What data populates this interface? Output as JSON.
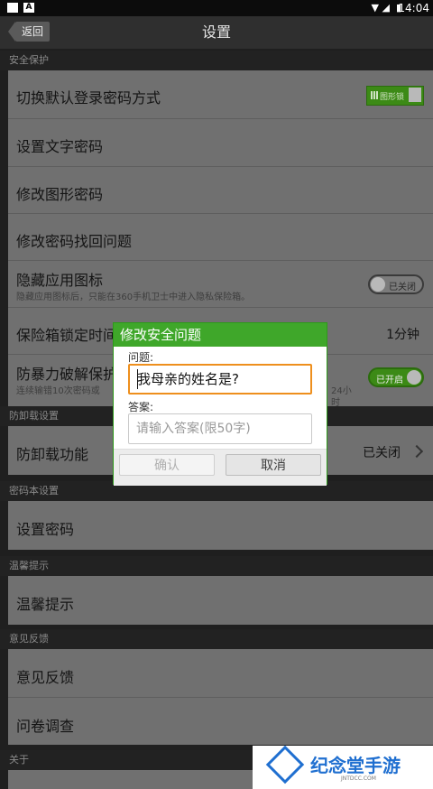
{
  "status_bar": {
    "notification_badge": "A",
    "time": "14:04"
  },
  "header": {
    "back_label": "返回",
    "title": "设置"
  },
  "sections": {
    "security": "安全保护",
    "anti_uninstall": "防卸载设置",
    "notes": "密码本设置",
    "tips": "温馨提示",
    "feedback": "意见反馈",
    "about": "关于"
  },
  "security_rows": {
    "switch_login": "切换默认登录密码方式",
    "pattern_switch_label": "图形锁",
    "set_text_password": "设置文字密码",
    "change_pattern": "修改图形密码",
    "change_recovery_question": "修改密码找回问题",
    "hide_icon": "隐藏应用图标",
    "hide_icon_sub": "隐藏应用图标后，只能在360手机卫士中进入隐私保险箱。",
    "hide_icon_toggle": "已关闭",
    "lock_time": "保险箱锁定时间",
    "lock_time_value": "1分钟",
    "brute_force": "防暴力破解保护",
    "brute_force_sub": "连续输错10次密码或",
    "brute_force_sub_tail": "24小",
    "brute_force_sub_tail2": "时",
    "brute_force_toggle": "已开启"
  },
  "anti_uninstall_rows": {
    "feature": "防卸载功能",
    "status": "已关闭"
  },
  "notes_rows": {
    "set_password": "设置密码"
  },
  "tips_rows": {
    "tips": "温馨提示"
  },
  "feedback_rows": {
    "feedback": "意见反馈",
    "survey": "问卷调查"
  },
  "dialog": {
    "title": "修改安全问题",
    "question_label": "问题:",
    "question_value": "我母亲的姓名是?",
    "answer_label": "答案:",
    "answer_placeholder": "请输入答案(限50字)",
    "confirm": "确认",
    "cancel": "取消"
  },
  "watermark": {
    "title": "纪念堂手游",
    "subtitle": "JNTDCC.COM"
  },
  "colors": {
    "accent_green": "#3fa72a",
    "input_focus": "#ee8f1d",
    "watermark_blue": "#1f6fd0"
  }
}
